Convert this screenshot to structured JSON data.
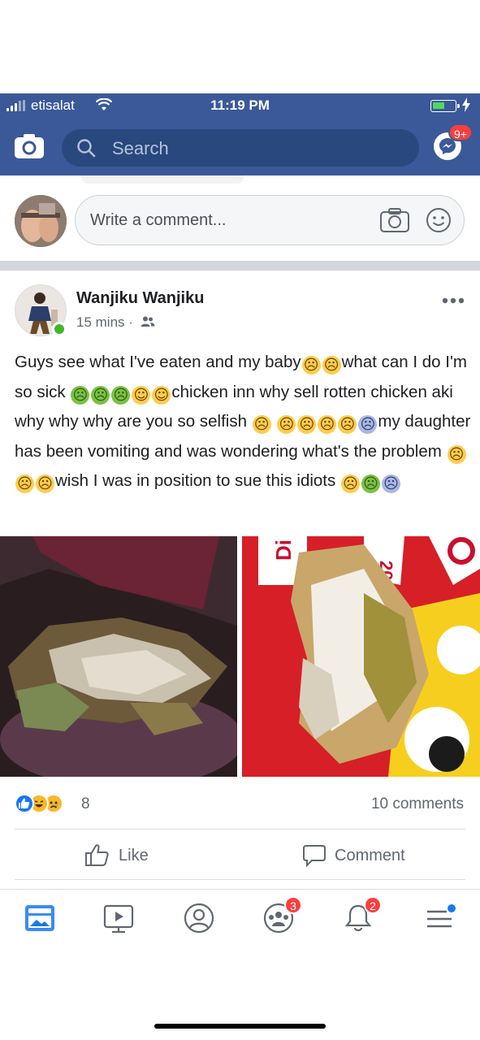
{
  "status_bar": {
    "carrier": "etisalat",
    "time": "11:19 PM"
  },
  "header": {
    "search_placeholder": "Search",
    "messenger_badge": "9+",
    "brand_color": "#3b5998"
  },
  "composer": {
    "placeholder": "Write a comment..."
  },
  "post": {
    "author": "Wanjiku Wanjiku",
    "time": "15 mins",
    "audience_icon": "friends-icon",
    "text_segments": [
      "Guys see what I've eaten and my baby",
      "what can I do I'm so sick",
      "chicken inn why sell rotten chicken aki why why why are you so selfish",
      "my daughter has been vomiting and was wondering what's the problem",
      "wish I was in position to sue this idiots"
    ],
    "reaction_count": "8",
    "comments_count": "10 comments",
    "actions": {
      "like": "Like",
      "comment": "Comment"
    }
  },
  "bottom_nav": {
    "items": [
      "news-feed-icon",
      "watch-icon",
      "profile-icon",
      "groups-icon",
      "notifications-icon",
      "menu-icon"
    ],
    "groups_badge": "3",
    "notifications_badge": "2"
  }
}
